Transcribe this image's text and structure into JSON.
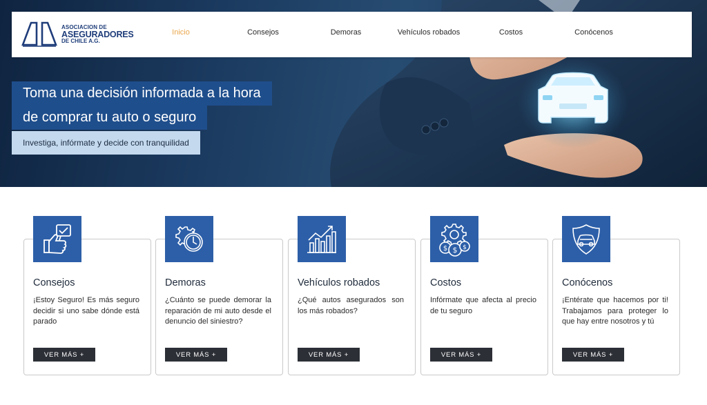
{
  "logo": {
    "line1": "ASOCIACION DE",
    "line2": "ASEGURADORES",
    "line3": "DE CHILE A.G."
  },
  "nav": {
    "items": [
      {
        "label": "Inicio",
        "active": true
      },
      {
        "label": "Consejos"
      },
      {
        "label": "Demoras"
      },
      {
        "label": "Vehículos robados"
      },
      {
        "label": "Costos"
      },
      {
        "label": "Conócenos"
      }
    ]
  },
  "hero": {
    "headline_line1": "Toma una decisión informada a la hora",
    "headline_line2": "de comprar tu auto o seguro",
    "subline": "Investiga, infórmate y decide con tranquilidad"
  },
  "cards": [
    {
      "icon": "thumbs-up-checklist-icon",
      "title": "Consejos",
      "text": "¡Estoy Seguro! Es más seguro decidir si uno sabe dónde está parado",
      "button": "VER MÁS +"
    },
    {
      "icon": "gear-clock-icon",
      "title": "Demoras",
      "text": "¿Cuánto se puede demorar la reparación de mi auto desde el denuncio del siniestro?",
      "button": "VER MÁS +"
    },
    {
      "icon": "bar-chart-icon",
      "title": "Vehículos robados",
      "text": "¿Qué autos asegurados son los más robados?",
      "button": "VER MÁS +"
    },
    {
      "icon": "gear-coins-icon",
      "title": "Costos",
      "text": "Infórmate que afecta al precio de tu seguro",
      "button": "VER MÁS +"
    },
    {
      "icon": "car-shield-icon",
      "title": "Conócenos",
      "text": "¡Entérate que hacemos por ti! Trabajamos para proteger lo que hay entre nosotros y tú",
      "button": "VER MÁS +"
    }
  ],
  "colors": {
    "accent": "#e9a64a",
    "brand_blue": "#1f4e8c",
    "icon_blue": "#2d5fa8",
    "button_dark": "#2c2f36",
    "subline_bg": "#c4d9ee"
  }
}
